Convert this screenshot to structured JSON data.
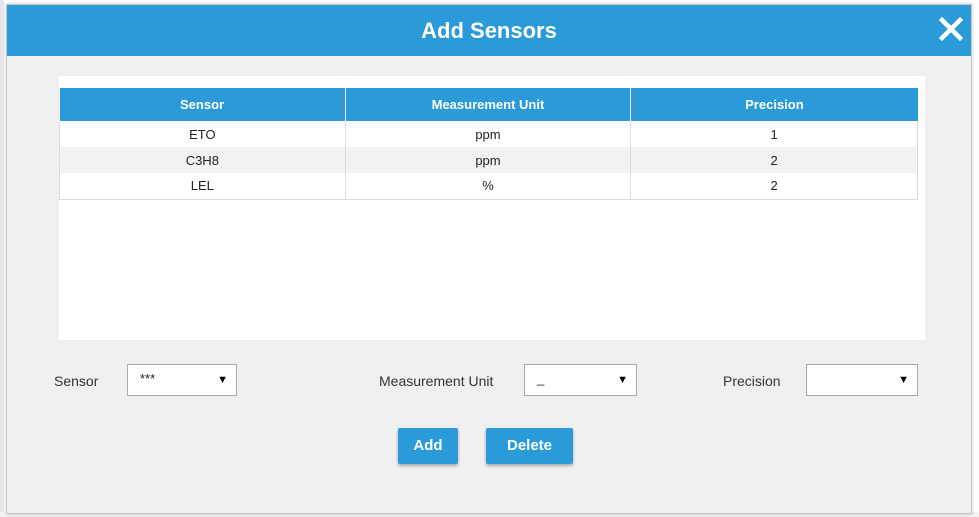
{
  "dialog": {
    "title": "Add Sensors",
    "close_icon": "close-icon"
  },
  "table": {
    "columns": [
      "Sensor",
      "Measurement Unit",
      "Precision"
    ],
    "rows": [
      {
        "sensor": "ETO",
        "unit": "ppm",
        "precision": "1"
      },
      {
        "sensor": "C3H8",
        "unit": "ppm",
        "precision": "2"
      },
      {
        "sensor": "LEL",
        "unit": "%",
        "precision": "2"
      }
    ]
  },
  "form": {
    "sensor_label": "Sensor",
    "sensor_value": "***",
    "unit_label": "Measurement Unit",
    "unit_value": "_",
    "precision_label": "Precision",
    "precision_value": ""
  },
  "buttons": {
    "add_label": "Add",
    "delete_label": "Delete"
  },
  "colors": {
    "accent": "#2b9ad8",
    "panel_bg": "#f0f0f0",
    "row_alt": "#f2f2f2"
  }
}
